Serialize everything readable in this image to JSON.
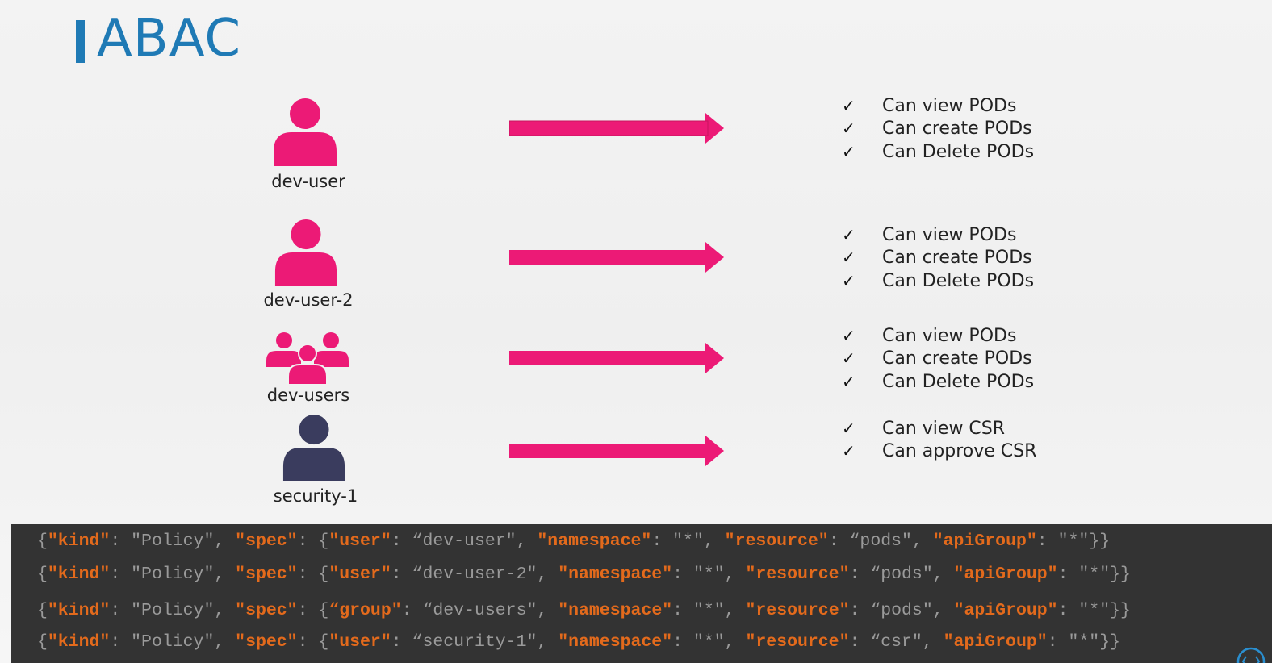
{
  "slide": {
    "title": "ABAC",
    "colors": {
      "title": "#1f7ab5",
      "user": "#ec1a76",
      "security_user": "#3a3c5e",
      "arrow": "#ec1a76",
      "code_key": "#e36a1c"
    }
  },
  "rows": [
    {
      "subject": "dev-user",
      "icon": "user-icon",
      "permissions": [
        "Can view PODs",
        "Can create PODs",
        "Can Delete PODs"
      ]
    },
    {
      "subject": "dev-user-2",
      "icon": "user-icon",
      "permissions": [
        "Can view PODs",
        "Can create PODs",
        "Can Delete PODs"
      ]
    },
    {
      "subject": "dev-users",
      "icon": "group-icon",
      "permissions": [
        "Can view PODs",
        "Can create PODs",
        "Can Delete PODs"
      ]
    },
    {
      "subject": "security-1",
      "icon": "user-icon",
      "permissions": [
        "Can view CSR",
        "Can approve CSR"
      ]
    }
  ],
  "check_glyph": "✓",
  "policies": [
    {
      "kind_key": "\"kind\"",
      "kind_val": "\"Policy\"",
      "spec_key": "\"spec\"",
      "subj_key": "\"user\"",
      "subj_val": "“dev-user\"",
      "ns_key": "\"namespace\"",
      "ns_val": "\"*\"",
      "res_key": "\"resource\"",
      "res_val": "“pods\"",
      "api_key": "\"apiGroup\"",
      "api_val": "\"*\""
    },
    {
      "kind_key": "\"kind\"",
      "kind_val": "\"Policy\"",
      "spec_key": "\"spec\"",
      "subj_key": "\"user\"",
      "subj_val": "“dev-user-2\"",
      "ns_key": "\"namespace\"",
      "ns_val": "\"*\"",
      "res_key": "\"resource\"",
      "res_val": "“pods\"",
      "api_key": "\"apiGroup\"",
      "api_val": "\"*\""
    },
    {
      "kind_key": "\"kind\"",
      "kind_val": "\"Policy\"",
      "spec_key": "\"spec\"",
      "subj_key": "“group\"",
      "subj_val": "“dev-users\"",
      "ns_key": "\"namespace\"",
      "ns_val": "\"*\"",
      "res_key": "\"resource\"",
      "res_val": "“pods\"",
      "api_key": "\"apiGroup\"",
      "api_val": "\"*\""
    },
    {
      "kind_key": "\"kind\"",
      "kind_val": "\"Policy\"",
      "spec_key": "\"spec\"",
      "subj_key": "\"user\"",
      "subj_val": "“security-1\"",
      "ns_key": "\"namespace\"",
      "ns_val": "\"*\"",
      "res_key": "\"resource\"",
      "res_val": "“csr\"",
      "api_key": "\"apiGroup\"",
      "api_val": "\"*\""
    }
  ]
}
